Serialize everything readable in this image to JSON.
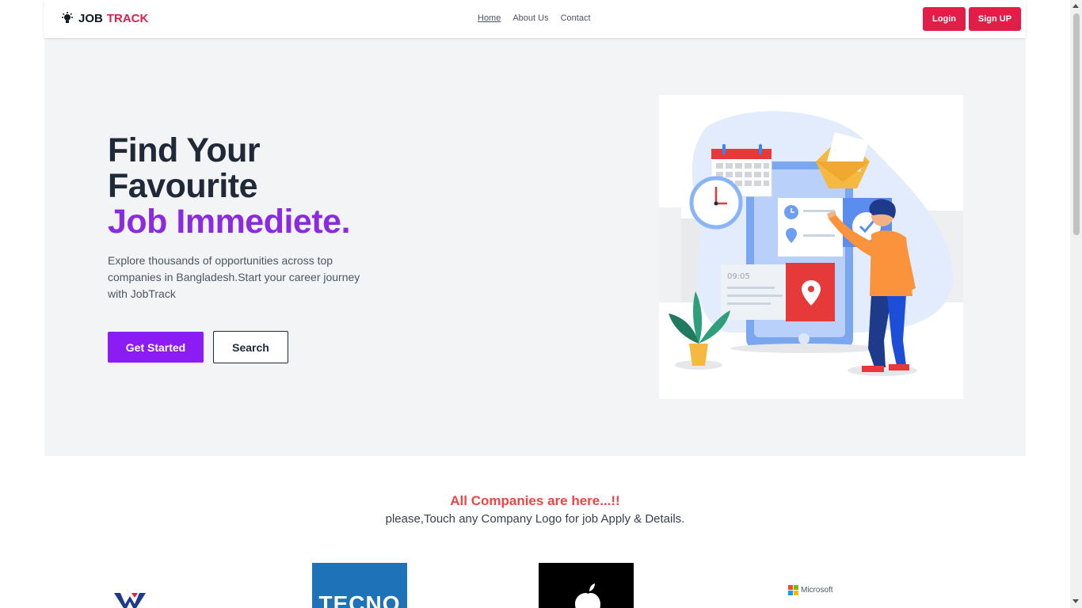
{
  "brand": {
    "job": "JOB",
    "track": "TRACK"
  },
  "nav": {
    "links": [
      "Home",
      "About Us",
      "Contact"
    ],
    "login_label": "Login",
    "signup_label": "Sign UP"
  },
  "hero": {
    "title_line1": "Find Your",
    "title_line2": "Favourite",
    "title_accent": "Job Immediete.",
    "description": "Explore thousands of opportunities across top companies in Bangladesh.Start your career journey with JobTrack",
    "get_started_label": "Get Started",
    "search_label": "Search",
    "illustration_clock_text": "09:05"
  },
  "companies": {
    "heading": "All Companies are here...!!",
    "subheading": "please,Touch any Company Logo for job Apply & Details.",
    "logos": {
      "tecno": "TECNO",
      "microsoft": "Microsoft"
    }
  },
  "colors": {
    "brand_red": "#e11d48",
    "accent_purple": "#8b1cf3",
    "heading_red": "#ef4444"
  }
}
